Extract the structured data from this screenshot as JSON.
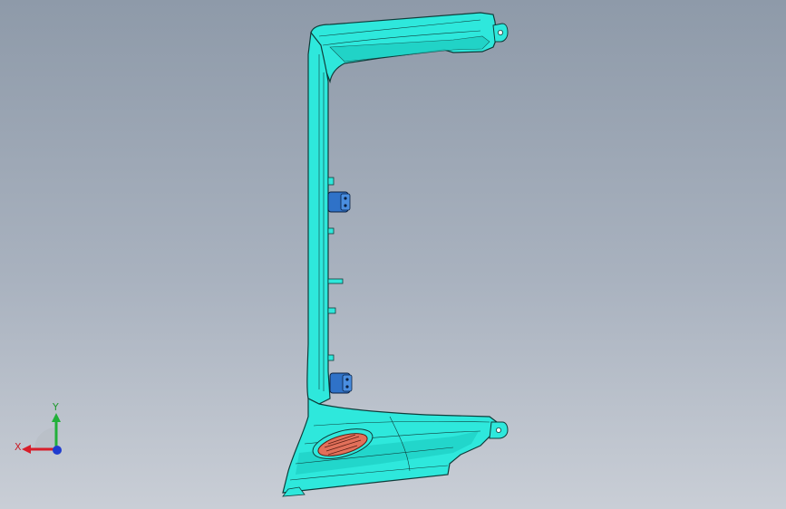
{
  "viewport": {
    "background_top": "#8e9aa9",
    "background_bottom": "#c9ced6"
  },
  "part": {
    "body_color": "#2ee8dc",
    "edge_color": "#0f3c3a",
    "clip_color": "#2f72c8",
    "vent_color": "#e2705a"
  },
  "triad": {
    "x_label": "X",
    "y_label": "Y",
    "x_color": "#d81e2a",
    "y_color": "#22b03a",
    "z_color": "#1f3ccf",
    "icon": "coordinate-triad-icon"
  }
}
